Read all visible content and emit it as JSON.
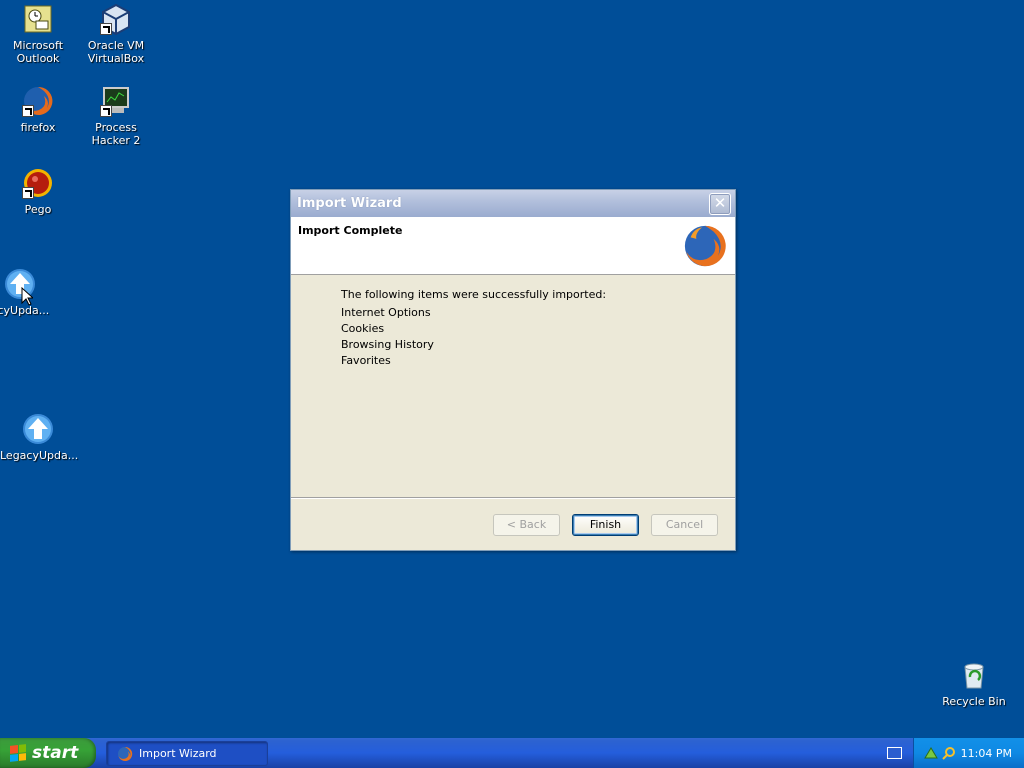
{
  "desktop": {
    "icons": [
      {
        "label": "Microsoft Outlook"
      },
      {
        "label": "Oracle VM VirtualBox"
      },
      {
        "label": "firefox"
      },
      {
        "label": "Process Hacker 2"
      },
      {
        "label": "Pego"
      },
      {
        "label": "acyUpda..."
      },
      {
        "label": "LegacyUpda..."
      },
      {
        "label": "Recycle Bin"
      }
    ]
  },
  "wizard": {
    "title": "Import Wizard",
    "heading": "Import Complete",
    "intro": "The following items were successfully imported:",
    "items": [
      "Internet Options",
      "Cookies",
      "Browsing History",
      "Favorites"
    ],
    "buttons": {
      "back": "< Back",
      "finish": "Finish",
      "cancel": "Cancel"
    }
  },
  "taskbar": {
    "start_label": "start",
    "task_label": "Import Wizard",
    "clock": "11:04 PM"
  },
  "colors": {
    "desktop": "#004e98",
    "accent": "#245edc"
  }
}
